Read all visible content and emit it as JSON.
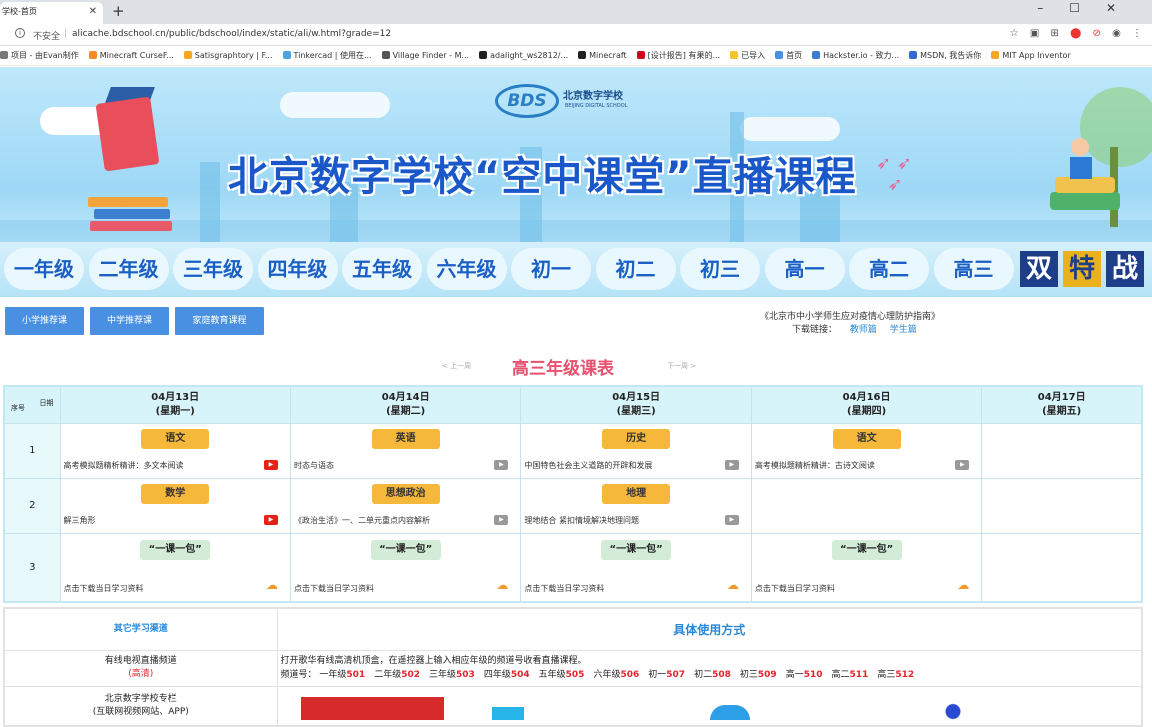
{
  "browser": {
    "tab_title": "学校-首页",
    "security_label": "不安全",
    "url": "alicache.bdschool.cn/public/bdschool/index/static/ali/w.html?grade=12",
    "bookmarks": [
      "项目 - 由Evan制作",
      "Minecraft CurseF...",
      "Satisgraphtory | F...",
      "Tinkercad | 使用在...",
      "Village Finder - M...",
      "adalight_ws2812/...",
      "Minecraft",
      "[设计报告] 有果的...",
      "已导入",
      "首页",
      "Hackster.io - 致力...",
      "MSDN, 我告诉你",
      "MIT App Inventor"
    ]
  },
  "banner": {
    "logo_text": "BDS",
    "logo_cn": "北京数字学校",
    "logo_en": "BEIJING DIGITAL SCHOOL",
    "title": "北京数字学校“空中课堂”直播课程"
  },
  "grades": [
    "一年级",
    "二年级",
    "三年级",
    "四年级",
    "五年级",
    "六年级",
    "初一",
    "初二",
    "初三",
    "高一",
    "高二",
    "高三"
  ],
  "promo_chars": [
    "双",
    "特",
    "战"
  ],
  "buttons": {
    "primary": "小学推荐课",
    "middle": "中学推荐课",
    "family": "家庭教育课程"
  },
  "guide": {
    "title": "《北京市中小学师生应对疫情心理防护指南》",
    "download_label": "下载链接：",
    "teacher_link": "教师篇",
    "student_link": "学生篇"
  },
  "schedule": {
    "prev": "< 上一周",
    "next": "下一周 >",
    "title": "高三年级课表",
    "corner_date": "日期",
    "corner_seq": "序号",
    "days": [
      {
        "date": "04月13日",
        "weekday": "(星期一)"
      },
      {
        "date": "04月14日",
        "weekday": "(星期二)"
      },
      {
        "date": "04月15日",
        "weekday": "(星期三)"
      },
      {
        "date": "04月16日",
        "weekday": "(星期四)"
      },
      {
        "date": "04月17日",
        "weekday": "(星期五)"
      }
    ],
    "rows": [
      {
        "no": "1",
        "cells": [
          {
            "subject": "语文",
            "desc": "高考模拟题精析精讲：多文本阅读"
          },
          {
            "subject": "英语",
            "desc": "时态与语态"
          },
          {
            "subject": "历史",
            "desc": "中国特色社会主义道路的开辟和发展"
          },
          {
            "subject": "语文",
            "desc": "高考模拟题精析精讲：古诗文阅读"
          },
          {
            "subject": "",
            "desc": ""
          }
        ]
      },
      {
        "no": "2",
        "cells": [
          {
            "subject": "数学",
            "desc": "解三角形"
          },
          {
            "subject": "思想政治",
            "desc": "《政治生活》一、二单元重点内容解析"
          },
          {
            "subject": "地理",
            "desc": "理地结合 紧扣情境解决地理问题"
          },
          {
            "subject": "",
            "desc": ""
          },
          {
            "subject": "",
            "desc": ""
          }
        ]
      },
      {
        "no": "3",
        "cells": [
          {
            "subject": "“一课一包”",
            "desc": "点击下载当日学习资料"
          },
          {
            "subject": "“一课一包”",
            "desc": "点击下载当日学习资料"
          },
          {
            "subject": "“一课一包”",
            "desc": "点击下载当日学习资料"
          },
          {
            "subject": "“一课一包”",
            "desc": "点击下载当日学习资料"
          },
          {
            "subject": "",
            "desc": ""
          }
        ]
      }
    ]
  },
  "channels": {
    "header_left": "其它学习渠道",
    "header_right": "具体使用方式",
    "tv_name": "有线电视直播频道",
    "tv_sub": "(高清)",
    "tv_desc": "打开歌华有线高清机顶盒，在遥控器上输入相应年级的频道号收看直播课程。",
    "channel_prefix": "频道号：",
    "channel_list": [
      {
        "grade": "一年级",
        "no": "501"
      },
      {
        "grade": "二年级",
        "no": "502"
      },
      {
        "grade": "三年级",
        "no": "503"
      },
      {
        "grade": "四年级",
        "no": "504"
      },
      {
        "grade": "五年级",
        "no": "505"
      },
      {
        "grade": "六年级",
        "no": "506"
      },
      {
        "grade": "初一",
        "no": "507"
      },
      {
        "grade": "初二",
        "no": "508"
      },
      {
        "grade": "初三",
        "no": "509"
      },
      {
        "grade": "高一",
        "no": "510"
      },
      {
        "grade": "高二",
        "no": "511"
      },
      {
        "grade": "高三",
        "no": "512"
      }
    ],
    "web_name": "北京数字学校专栏",
    "web_sub": "(互联网视频网站、APP)"
  },
  "colors": {
    "accent_blue": "#4a90e2",
    "title_red": "#e8506f",
    "subject_orange": "#f6b83b",
    "package_green": "#d3ecd8",
    "header_cyan": "#d8f4fb"
  }
}
